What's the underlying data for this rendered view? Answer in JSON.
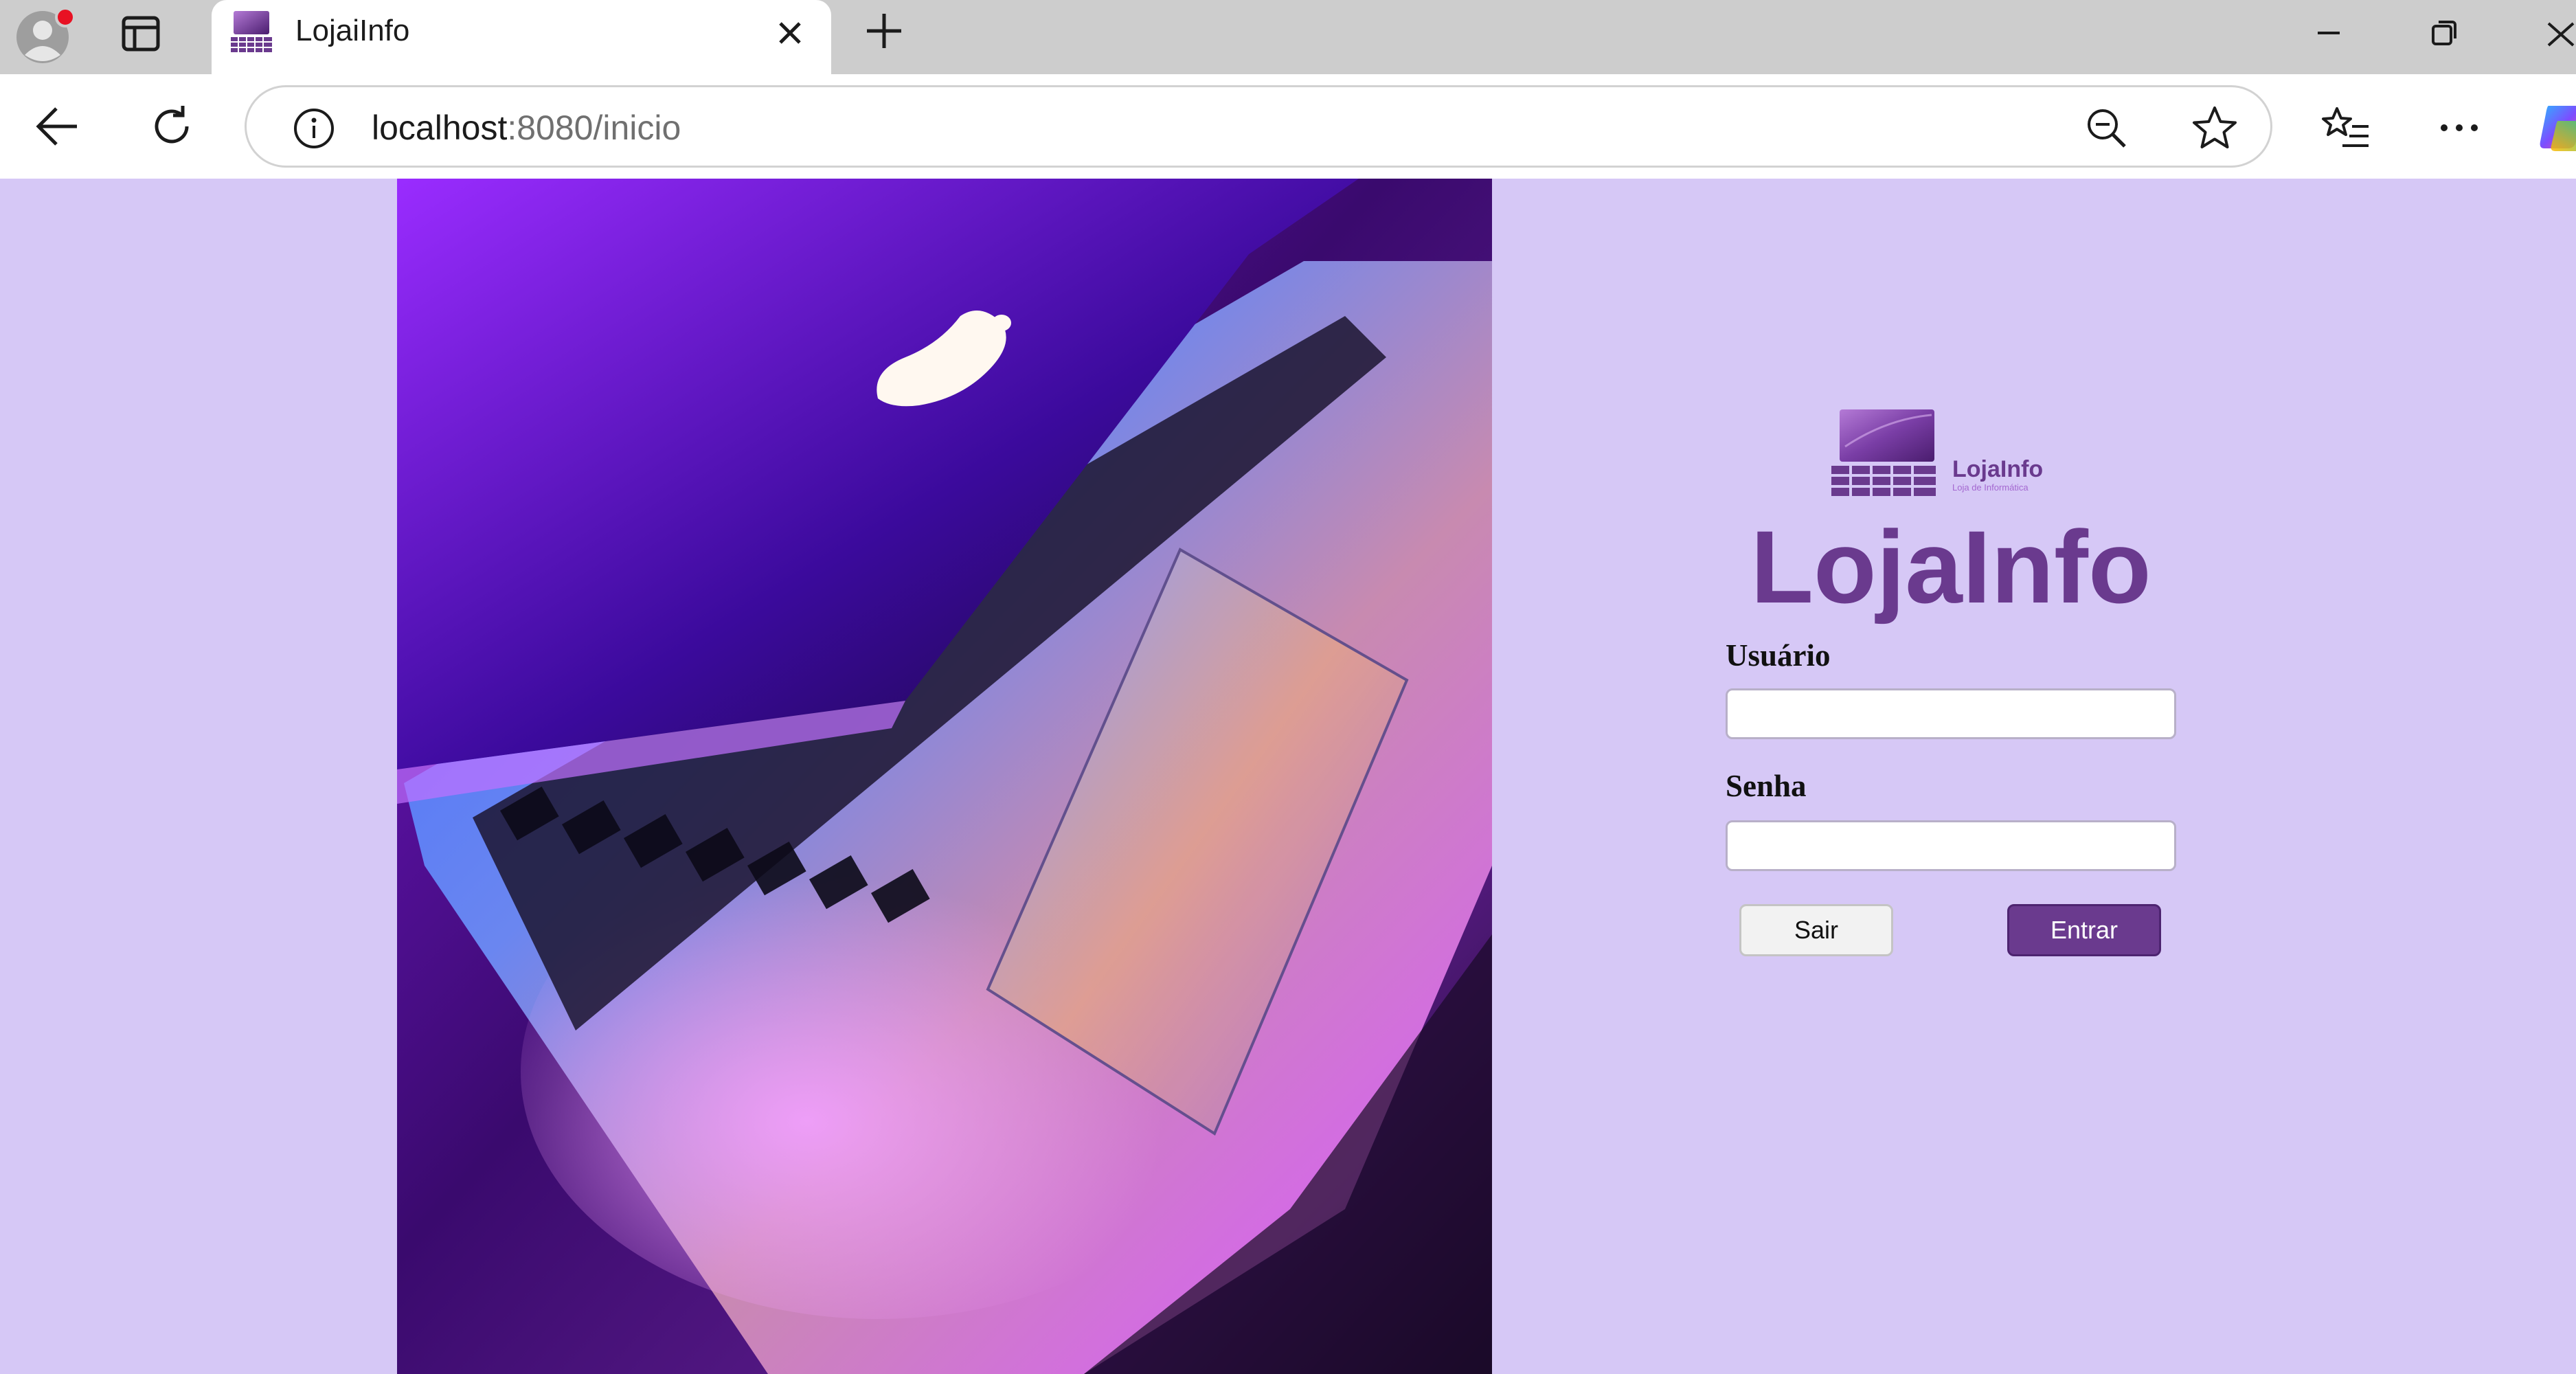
{
  "browser": {
    "tab_title": "LojaiInfo",
    "url_host": "localhost",
    "url_path": ":8080/inicio"
  },
  "login": {
    "logo_text": "LojaInfo",
    "logo_subtext": "Loja de Informática",
    "title": "LojaInfo",
    "user_label": "Usuário",
    "user_value": "",
    "password_label": "Senha",
    "password_value": "",
    "exit_button": "Sair",
    "enter_button": "Entrar"
  },
  "colors": {
    "page_background": "#d6c8f6",
    "brand_purple": "#6a3a8e",
    "tabbar": "#cdcdcd"
  },
  "icons": {
    "profile": "profile-avatar-icon",
    "tab_actions": "tab-actions-icon",
    "close": "close-icon",
    "new_tab": "plus-icon",
    "back": "arrow-left-icon",
    "reload": "reload-icon",
    "site_info": "info-icon",
    "zoom": "zoom-out-icon",
    "favorite": "star-icon",
    "favorites": "favorites-list-icon",
    "more": "more-icon",
    "copilot": "copilot-icon"
  }
}
